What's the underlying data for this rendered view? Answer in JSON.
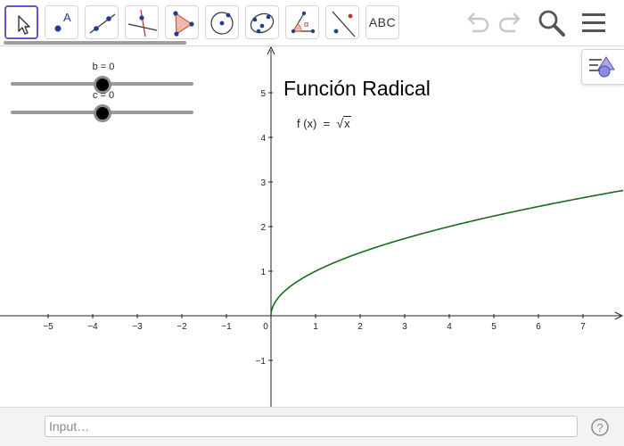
{
  "toolbar": {
    "tools": [
      {
        "name": "move",
        "icon": "move-arrow-icon",
        "active": true
      },
      {
        "name": "point",
        "icon": "point-icon",
        "label": "A"
      },
      {
        "name": "line",
        "icon": "line-through-points-icon"
      },
      {
        "name": "perpendicular",
        "icon": "perpendicular-line-icon"
      },
      {
        "name": "polygon",
        "icon": "polygon-icon"
      },
      {
        "name": "circle",
        "icon": "circle-center-point-icon"
      },
      {
        "name": "conic",
        "icon": "conic-through-points-icon"
      },
      {
        "name": "angle",
        "icon": "angle-icon",
        "label": "α"
      },
      {
        "name": "reflect",
        "icon": "reflect-about-line-icon"
      },
      {
        "name": "text",
        "icon": "text-icon",
        "label": "ABC"
      }
    ],
    "right_icons": [
      "undo-icon",
      "redo-icon",
      "search-icon",
      "menu-icon"
    ],
    "progress_fraction": 0.54
  },
  "sliders": [
    {
      "label": "b = 0",
      "value": 0,
      "min": -5,
      "max": 5
    },
    {
      "label": "c = 0",
      "value": 0,
      "min": -5,
      "max": 5
    }
  ],
  "graph": {
    "title": "Función Radical",
    "formula_lhs": "f (x)",
    "formula_eq": "=",
    "formula_radicand": "x",
    "curve_color": "#1a6b1a",
    "x_ticks": [
      "-5",
      "-4",
      "-3",
      "-2",
      "-1",
      "0",
      "1",
      "2",
      "3",
      "4",
      "5",
      "6",
      "7"
    ],
    "y_ticks": [
      "-1",
      "1",
      "2",
      "3",
      "4",
      "5"
    ]
  },
  "chart_data": {
    "type": "line",
    "function": "sqrt(x)",
    "xlim": [
      -6,
      7.9
    ],
    "ylim": [
      -2,
      6
    ],
    "series": [
      {
        "values": [
          [
            0,
            0
          ],
          [
            0.1,
            0.32
          ],
          [
            0.5,
            0.71
          ],
          [
            1,
            1
          ],
          [
            2,
            1.41
          ],
          [
            3,
            1.73
          ],
          [
            4,
            2
          ],
          [
            5,
            2.24
          ],
          [
            6,
            2.45
          ],
          [
            7,
            2.65
          ],
          [
            7.8,
            2.79
          ]
        ]
      }
    ]
  },
  "input_bar": {
    "placeholder": "Input…",
    "help_icon": "help-icon"
  },
  "style_bar_icon": "graphics-style-icon"
}
